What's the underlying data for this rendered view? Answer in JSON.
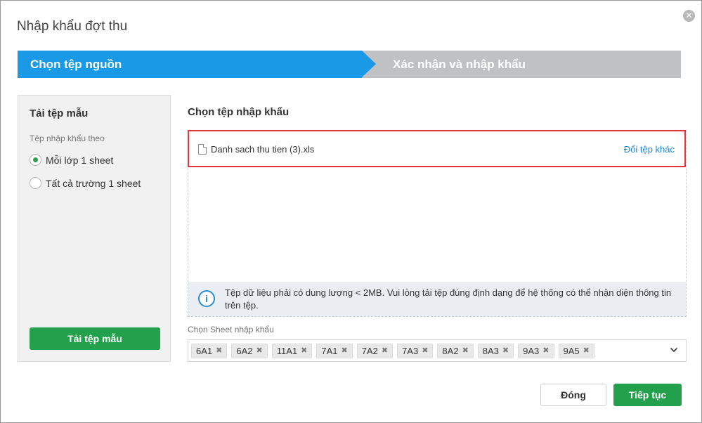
{
  "dialog": {
    "title": "Nhập khẩu đợt thu",
    "close_icon": "close-icon"
  },
  "steps": [
    {
      "label": "Chọn tệp nguồn",
      "active": true
    },
    {
      "label": "Xác nhận và nhập khẩu",
      "active": false
    }
  ],
  "template_panel": {
    "title": "Tải tệp mẫu",
    "subtitle": "Tệp nhập khẩu theo",
    "options": [
      {
        "label": "Mỗi lớp 1 sheet",
        "checked": true
      },
      {
        "label": "Tất cả trường 1 sheet",
        "checked": false
      }
    ],
    "download_label": "Tải tệp mẫu"
  },
  "import": {
    "section_title": "Chọn tệp nhập khẩu",
    "file_name": "Danh sach thu tien (3).xls",
    "change_file_label": "Đổi tệp khác",
    "info_text": "Tệp dữ liệu phải có dung lượng < 2MB. Vui lòng tải tệp đúng định dạng để hệ thống có thể nhận diện thông tin trên tệp."
  },
  "sheets": {
    "label": "Chọn Sheet nhập khẩu",
    "selected": [
      "6A1",
      "6A2",
      "11A1",
      "7A1",
      "7A2",
      "7A3",
      "8A2",
      "8A3",
      "9A3",
      "9A5"
    ]
  },
  "footer": {
    "close_label": "Đóng",
    "next_label": "Tiếp tục"
  },
  "colors": {
    "accent_blue": "#1a99e6",
    "primary_green": "#22a04b",
    "highlight_red": "#e5343a",
    "inactive_step": "#bfc1c3"
  }
}
